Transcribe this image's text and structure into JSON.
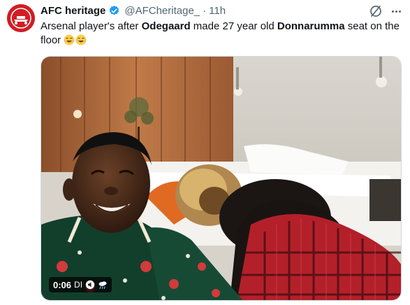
{
  "author": {
    "name": "AFC heritage",
    "handle": "@AFCheritage_",
    "separator": "·",
    "time": "11h"
  },
  "tweet": {
    "text_part1": "Arsenal player's after ",
    "name1": "Odegaard",
    "text_part2": " made 27 year old ",
    "name2": "Donnarumma",
    "text_part3": " seat on the floor"
  },
  "video": {
    "duration": "0:06",
    "tag": "DI"
  },
  "colors": {
    "brand": "#d11d23",
    "verified": "#1d9bf0",
    "muted": "#536471"
  },
  "icons": [
    "verified-badge-icon",
    "grok-icon",
    "more-icon",
    "laughing-emoji-icon",
    "sound-icon",
    "weather-icon"
  ]
}
